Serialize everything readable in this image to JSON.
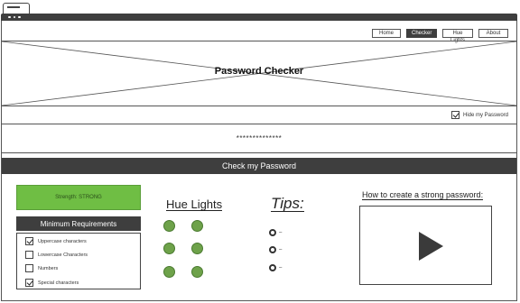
{
  "browser": {
    "tab_icon": "tab-icon",
    "window_dots": [
      "dot",
      "dot",
      "dot"
    ]
  },
  "nav": {
    "items": [
      {
        "label": "Home",
        "active": false
      },
      {
        "label": "Checker",
        "active": true
      },
      {
        "label": "Hue Lights",
        "active": false
      },
      {
        "label": "About",
        "active": false
      }
    ]
  },
  "banner": {
    "title": "Password Checker"
  },
  "hide_password": {
    "label": "Hide my Password",
    "checked": true
  },
  "password_field": {
    "value": "**************"
  },
  "check_button": {
    "label": "Check my Password"
  },
  "strength": {
    "label": "Strength: STRONG",
    "color": "#6fbe44"
  },
  "requirements": {
    "title": "Minimum Requirements",
    "items": [
      {
        "label": "Uppercase characters",
        "checked": true
      },
      {
        "label": "Lowercase Characters",
        "checked": false
      },
      {
        "label": "Numbers",
        "checked": false
      },
      {
        "label": "Special characters",
        "checked": true
      }
    ]
  },
  "hue_lights": {
    "title": "Hue Lights",
    "light_color": "#6ea24a",
    "count": 6
  },
  "tips": {
    "title": "Tips:",
    "items": [
      "–",
      "–",
      "–"
    ]
  },
  "video": {
    "title": "How to create a strong password:",
    "icon": "play-icon"
  },
  "colors": {
    "dark": "#3e3e3e",
    "accent_green": "#6fbe44"
  }
}
